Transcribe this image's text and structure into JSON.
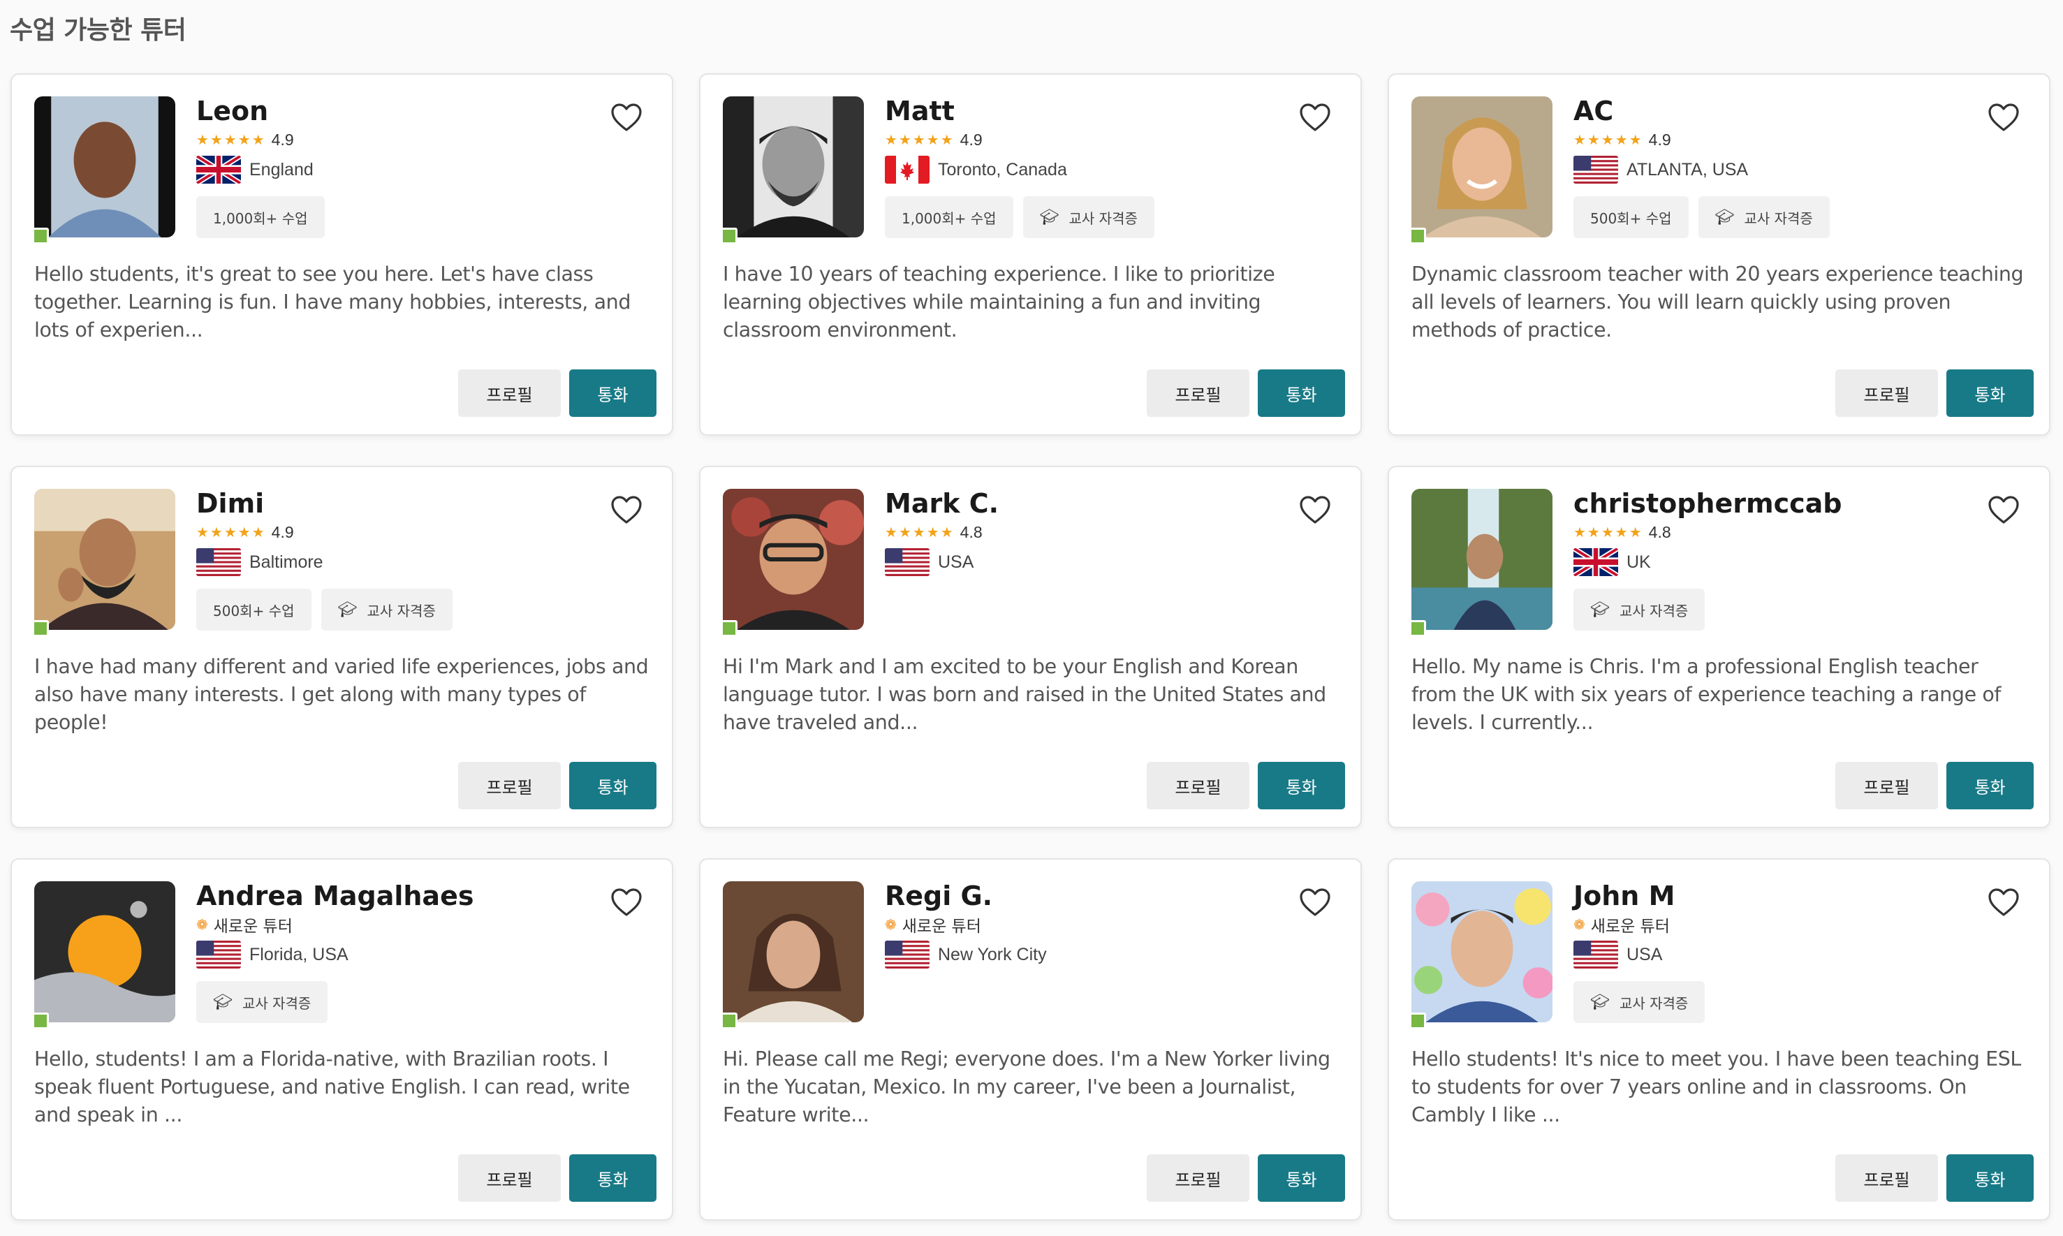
{
  "page": {
    "title": "수업 가능한 튜터"
  },
  "buttons": {
    "profile": "프로필",
    "call": "통화"
  },
  "icons": {
    "heart": "heart-icon",
    "cap": "graduation-cap-icon",
    "new": "flame-icon",
    "star": "star-icon"
  },
  "colors": {
    "primary": "#187a87",
    "star": "#f2a31a",
    "online": "#78b743",
    "new": "#f28b10"
  },
  "tutors": [
    {
      "name": "Leon",
      "stars": "★★★★★",
      "rating": "4.9",
      "flag": "uk",
      "location": "England",
      "tags": [
        "1,000회+ 수업"
      ],
      "description": "Hello students, it's great to see you here. Let's have class together. Learning is fun. I have many hobbies, interests, and lots of experien..."
    },
    {
      "name": "Matt",
      "stars": "★★★★★",
      "rating": "4.9",
      "flag": "canada",
      "location": "Toronto, Canada",
      "tags": [
        "1,000회+ 수업",
        "교사 자격증"
      ],
      "description": "I have 10 years of teaching experience. I like to prioritize learning objectives while maintaining a fun and inviting classroom environment."
    },
    {
      "name": "AC",
      "stars": "★★★★★",
      "rating": "4.9",
      "flag": "usa",
      "location": "ATLANTA, USA",
      "tags": [
        "500회+ 수업",
        "교사 자격증"
      ],
      "description": "Dynamic classroom teacher with 20 years experience teaching all levels of learners. You will learn quickly using proven methods of practice."
    },
    {
      "name": "Dimi",
      "stars": "★★★★★",
      "rating": "4.9",
      "flag": "usa",
      "location": "Baltimore",
      "tags": [
        "500회+ 수업",
        "교사 자격증"
      ],
      "description": "I have had many different and varied life experiences, jobs and also have many interests. I get along with many types of people!"
    },
    {
      "name": "Mark C.",
      "stars": "★★★★★",
      "rating": "4.8",
      "flag": "usa",
      "location": "USA",
      "tags": [],
      "description": "Hi I'm Mark and I am excited to be your English and Korean language tutor. I was born and raised in the United States and have traveled and..."
    },
    {
      "name": "christophermccab",
      "stars": "★★★★★",
      "rating": "4.8",
      "flag": "uk",
      "location": "UK",
      "tags": [
        "교사 자격증"
      ],
      "description": "Hello. My name is Chris. I'm a professional English teacher from the UK with six years of experience teaching a range of levels. I currently..."
    },
    {
      "name": "Andrea Magalhaes",
      "newbadge": "새로운 튜터",
      "flag": "usa",
      "location": "Florida, USA",
      "tags": [
        "교사 자격증"
      ],
      "description": "Hello, students! I am a Florida-native, with Brazilian roots. I speak fluent Portuguese, and native English. I can read, write and speak in ..."
    },
    {
      "name": "Regi G.",
      "newbadge": "새로운 튜터",
      "flag": "usa",
      "location": "New York City",
      "tags": [],
      "description": "Hi. Please call me Regi; everyone does. I'm a New Yorker living in the Yucatan, Mexico. In my career, I've been a Journalist, Feature write..."
    },
    {
      "name": "John M",
      "newbadge": "새로운 튜터",
      "flag": "usa",
      "location": "USA",
      "tags": [
        "교사 자격증"
      ],
      "description": "Hello students! It's nice to meet you. I have been teaching ESL to students for over 7 years online and in classrooms. On Cambly I like ..."
    }
  ]
}
